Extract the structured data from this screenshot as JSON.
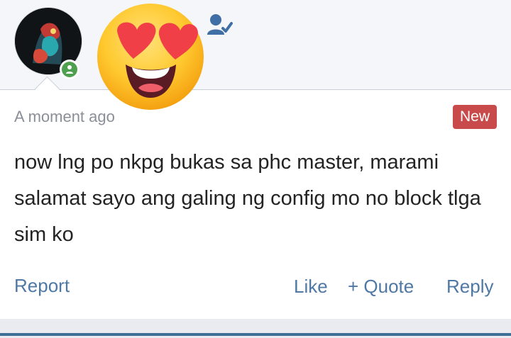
{
  "post": {
    "timestamp": "A moment ago",
    "badge": "New",
    "message": "now lng po nkpg bukas sa phc master, marami salamat sayo ang galing ng config mo no block tlga sim ko"
  },
  "actions": {
    "report": "Report",
    "like": "Like",
    "quote": "+ Quote",
    "reply": "Reply"
  },
  "icons": {
    "avatar": "avatar",
    "online": "online-status-icon",
    "emoji": "heart-eyes-emoji",
    "follow": "user-check-icon"
  },
  "colors": {
    "link": "#4f78a4",
    "badge": "#c94a4a",
    "online": "#4ea04e"
  }
}
